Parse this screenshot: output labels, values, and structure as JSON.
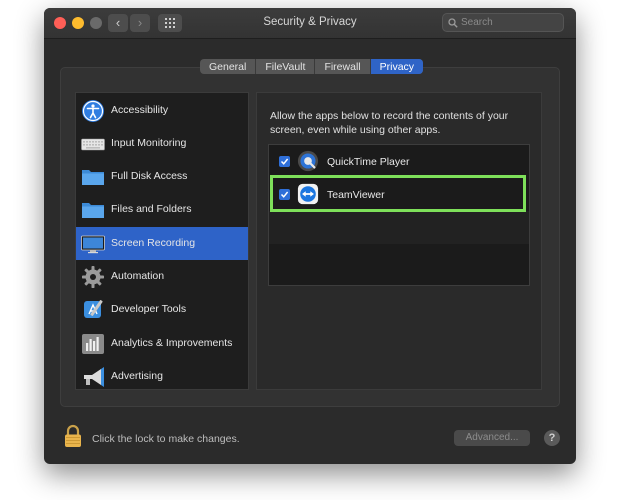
{
  "window": {
    "title": "Security & Privacy"
  },
  "titlebar": {
    "back_glyph": "‹",
    "forward_glyph": "›",
    "search_placeholder": "Search",
    "traffic_colors": {
      "close": "#ff5f57",
      "minimize": "#febc2e",
      "maximize": "#6a6a6a"
    }
  },
  "tabs": [
    {
      "label": "General",
      "active": false
    },
    {
      "label": "FileVault",
      "active": false
    },
    {
      "label": "Firewall",
      "active": false
    },
    {
      "label": "Privacy",
      "active": true
    }
  ],
  "sidebar": {
    "items": [
      {
        "label": "Accessibility",
        "icon": "accessibility-icon",
        "selected": false
      },
      {
        "label": "Input Monitoring",
        "icon": "keyboard-icon",
        "selected": false
      },
      {
        "label": "Full Disk Access",
        "icon": "folder-icon",
        "selected": false
      },
      {
        "label": "Files and Folders",
        "icon": "folder-icon",
        "selected": false
      },
      {
        "label": "Screen Recording",
        "icon": "display-icon",
        "selected": true
      },
      {
        "label": "Automation",
        "icon": "gear-icon",
        "selected": false
      },
      {
        "label": "Developer Tools",
        "icon": "developer-tools-icon",
        "selected": false
      },
      {
        "label": "Analytics & Improvements",
        "icon": "analytics-icon",
        "selected": false
      },
      {
        "label": "Advertising",
        "icon": "megaphone-icon",
        "selected": false
      }
    ]
  },
  "main": {
    "description": "Allow the apps below to record the contents of your screen, even while using other apps.",
    "apps": [
      {
        "label": "QuickTime Player",
        "checked": true,
        "icon": "quicktime-icon"
      },
      {
        "label": "TeamViewer",
        "checked": true,
        "icon": "teamviewer-icon"
      }
    ]
  },
  "footer": {
    "lock_text": "Click the lock to make changes.",
    "advanced_label": "Advanced...",
    "help_label": "?"
  },
  "colors": {
    "accent": "#2f64c7",
    "highlight_border": "#7ee05a"
  }
}
